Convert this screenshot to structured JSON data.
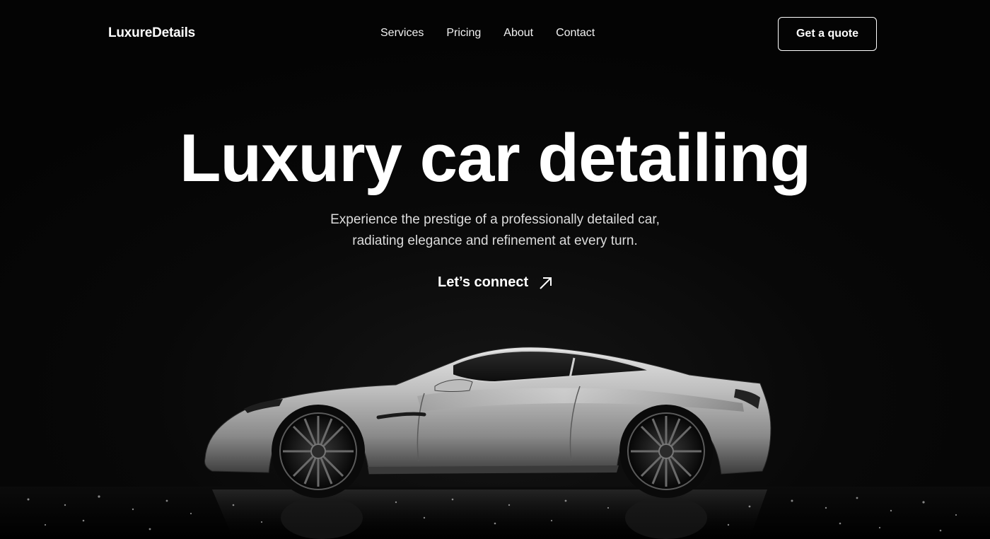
{
  "brand": {
    "logo_text": "LuxureDetails"
  },
  "nav": {
    "links": [
      {
        "label": "Services"
      },
      {
        "label": "Pricing"
      },
      {
        "label": "About"
      },
      {
        "label": "Contact"
      }
    ],
    "cta_label": "Get a quote"
  },
  "hero": {
    "title": "Luxury car detailing",
    "subtitle_line1": "Experience the prestige of a professionally detailed car,",
    "subtitle_line2": "radiating elegance and refinement at every turn.",
    "cta_label": "Let’s connect",
    "cta_icon": "arrow-up-right-icon"
  },
  "image": {
    "subject": "silver-sports-car"
  },
  "colors": {
    "background": "#060606",
    "text": "#ffffff",
    "subtext": "#dcdcdc"
  }
}
